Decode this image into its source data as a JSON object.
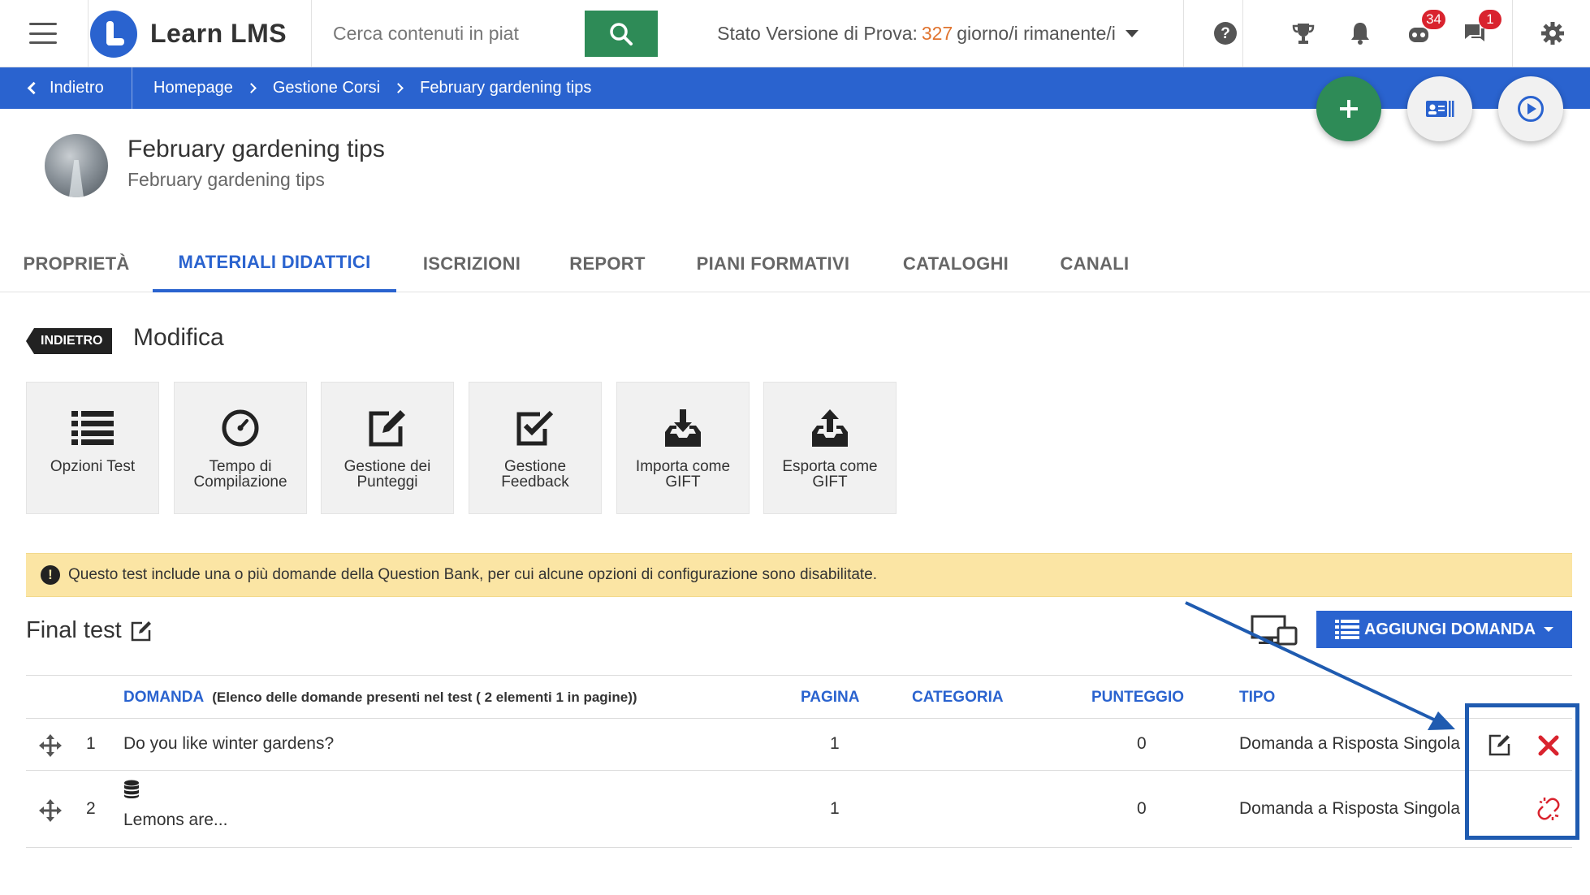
{
  "topbar": {
    "logo_text": "Learn LMS",
    "search_placeholder": "Cerca contenuti in piat",
    "trial_label": "Stato Versione di Prova:",
    "trial_days": "327",
    "trial_suffix": "giorno/i rimanente/i",
    "notifications_badge": "34",
    "messages_badge": "1"
  },
  "breadcrumb": {
    "back_label": "Indietro",
    "items": [
      "Homepage",
      "Gestione Corsi",
      "February gardening tips"
    ]
  },
  "course": {
    "title": "February gardening tips",
    "subtitle": "February gardening tips"
  },
  "tabs": [
    {
      "label": "PROPRIETÀ",
      "active": false
    },
    {
      "label": "MATERIALI DIDATTICI",
      "active": true
    },
    {
      "label": "ISCRIZIONI",
      "active": false
    },
    {
      "label": "REPORT",
      "active": false
    },
    {
      "label": "PIANI FORMATIVI",
      "active": false
    },
    {
      "label": "CATALOGHI",
      "active": false
    },
    {
      "label": "CANALI",
      "active": false
    }
  ],
  "section": {
    "back_tag": "INDIETRO",
    "title": "Modifica"
  },
  "tools": [
    {
      "label": "Opzioni Test",
      "icon": "list-icon"
    },
    {
      "label": "Tempo di Compilazione",
      "icon": "stopwatch-icon"
    },
    {
      "label": "Gestione dei Punteggi",
      "icon": "edit-square-icon"
    },
    {
      "label": "Gestione Feedback",
      "icon": "check-square-icon"
    },
    {
      "label": "Importa come GIFT",
      "icon": "inbox-download-icon"
    },
    {
      "label": "Esporta come GIFT",
      "icon": "inbox-upload-icon"
    }
  ],
  "notice": {
    "text": "Questo test include una o più domande della Question Bank, per cui alcune opzioni di configurazione sono disabilitate."
  },
  "test": {
    "title": "Final test",
    "add_question_label": "AGGIUNGI DOMANDA"
  },
  "table": {
    "headers": {
      "domanda": "DOMANDA",
      "domanda_note": "(Elenco delle domande presenti nel test ( 2 elementi 1 in pagine))",
      "pagina": "PAGINA",
      "categoria": "CATEGORIA",
      "punteggio": "PUNTEGGIO",
      "tipo": "TIPO"
    },
    "rows": [
      {
        "num": "1",
        "question": "Do you like winter gardens?",
        "page": "1",
        "category": "",
        "score": "0",
        "type": "Domanda a Risposta Singola",
        "from_bank": false
      },
      {
        "num": "2",
        "question": "Lemons are...",
        "page": "1",
        "category": "",
        "score": "0",
        "type": "Domanda a Risposta Singola",
        "from_bank": true
      }
    ]
  },
  "colors": {
    "primary": "#2a63cf",
    "success": "#2e8b57",
    "danger": "#d9232e",
    "notice_bg": "#fbe5a4",
    "trial_accent": "#e0742f"
  }
}
